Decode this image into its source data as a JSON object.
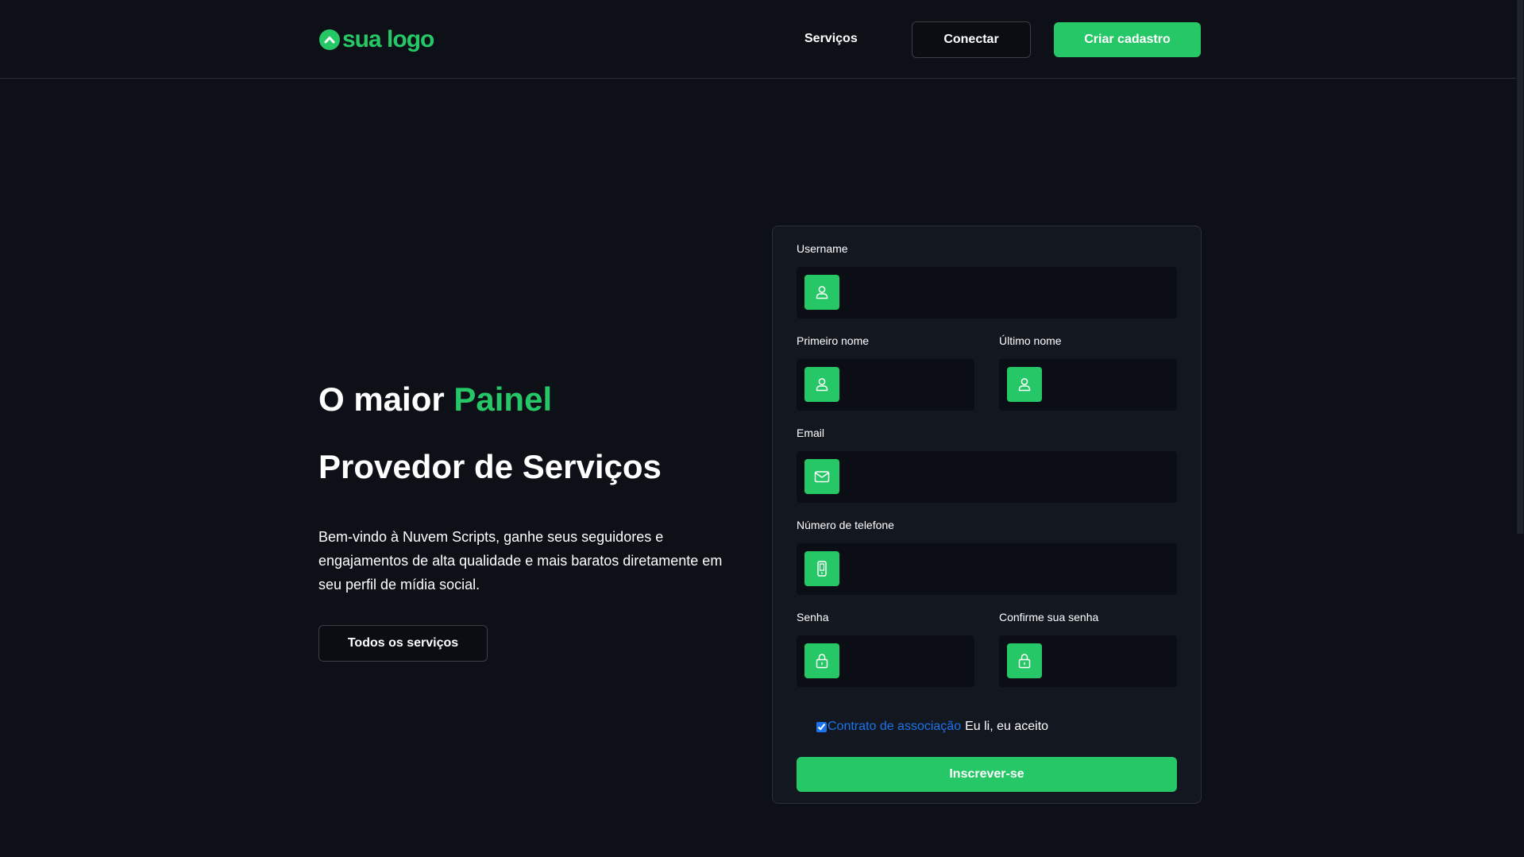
{
  "header": {
    "logo_text": "sua logo",
    "nav_services": "Serviços",
    "login_label": "Conectar",
    "signup_label": "Criar cadastro"
  },
  "hero": {
    "title_prefix": "O maior ",
    "title_accent": "Painel",
    "title_line2": "Provedor de Serviços",
    "description": "Bem-vindo à Nuvem Scripts, ganhe seus seguidores e engajamentos de alta qualidade e mais baratos diretamente em seu perfil de mídia social.",
    "services_button": "Todos os serviços"
  },
  "form": {
    "username_label": "Username",
    "first_name_label": "Primeiro nome",
    "last_name_label": "Último nome",
    "email_label": "Email",
    "phone_label": "Número de telefone",
    "password_label": "Senha",
    "confirm_password_label": "Confirme sua senha",
    "agreement_link": "Contrato de associação",
    "agreement_text": "Eu li, eu aceito",
    "agreement_checked": true,
    "submit_label": "Inscrever-se",
    "icons": {
      "username": "user-icon",
      "first_name": "user-icon",
      "last_name": "user-icon",
      "email": "envelope-icon",
      "phone": "phone-icon",
      "password": "lock-icon",
      "confirm_password": "lock-icon"
    }
  },
  "colors": {
    "accent": "#26c766",
    "background": "#0d1017",
    "card": "#131820",
    "input": "#0b0e14",
    "link": "#1a73e8"
  }
}
